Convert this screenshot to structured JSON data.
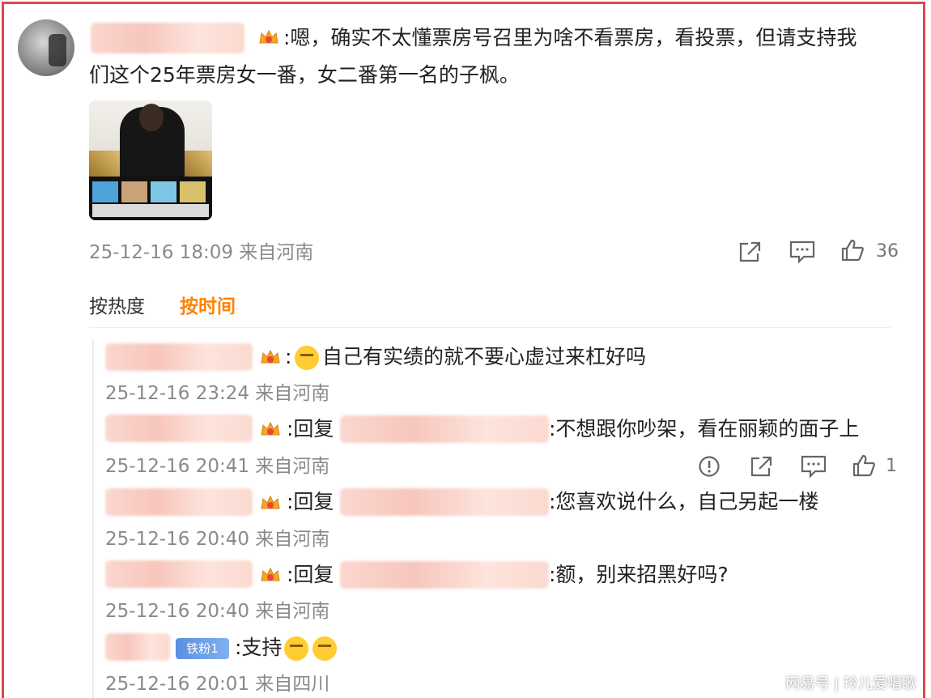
{
  "main_comment": {
    "text_line1": ":嗯，确实不太懂票房号召里为啥不看票房，看投票，但请支持我",
    "text_line2": "们这个25年票房女一番，女二番第一名的子枫。",
    "meta": "25-12-16 18:09 来自河南",
    "like_count": "36"
  },
  "sort": {
    "hot_label": "按热度",
    "time_label": "按时间",
    "active": "time"
  },
  "replies": [
    {
      "text": "自己有实绩的就不要心虚过来杠好吗",
      "meta": "25-12-16 23:24 来自河南"
    },
    {
      "prefix": ":回复",
      "text": ":不想跟你吵架，看在丽颖的面子上",
      "meta": "25-12-16 20:41 来自河南",
      "like_count": "1"
    },
    {
      "prefix": ":回复",
      "text": ":您喜欢说什么，自己另起一楼",
      "meta": "25-12-16 20:40 来自河南"
    },
    {
      "prefix": ":回复",
      "text": ":额，别来招黑好吗?",
      "meta": "25-12-16 20:40 来自河南"
    },
    {
      "badge": "铁粉1",
      "text": ":支持",
      "meta": "25-12-16 20:01 来自四川"
    }
  ],
  "watermark": "网易号 | 玲儿爱唱歌",
  "colors": {
    "accent": "#ff8200",
    "frame": "#e0474c",
    "meta": "#8a8a8a"
  },
  "icons": [
    "share-icon",
    "comment-icon",
    "like-icon",
    "report-icon",
    "crown-badge-icon"
  ]
}
